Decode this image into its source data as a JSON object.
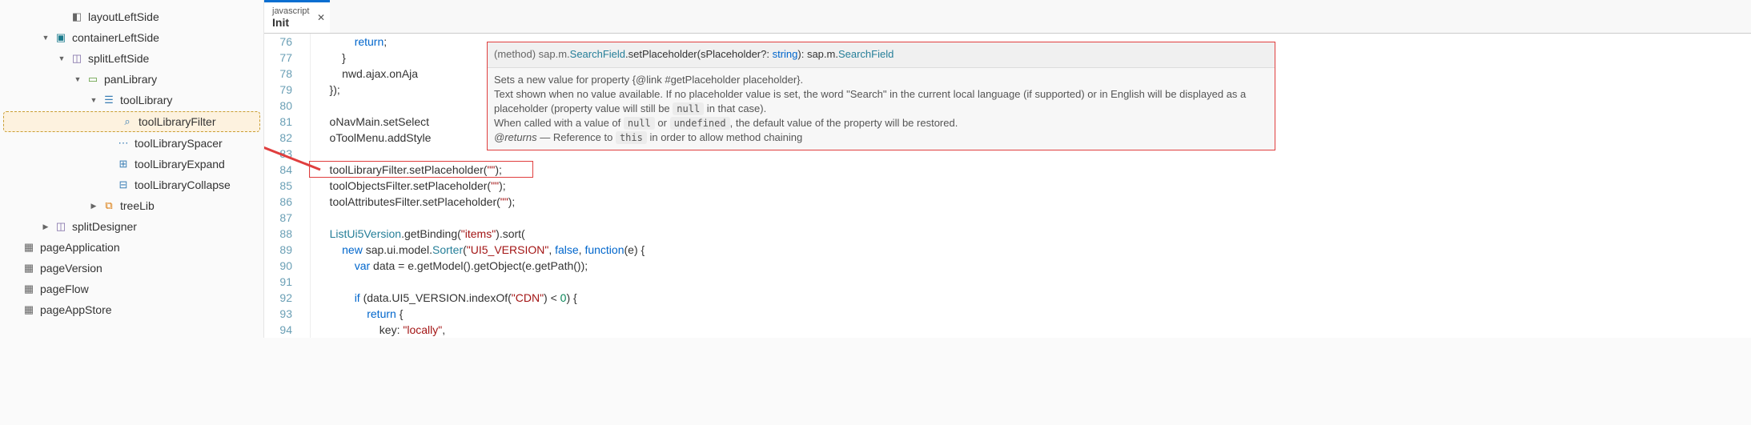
{
  "tree": {
    "items": [
      {
        "indent": 70,
        "chevron": "",
        "icon": "layout",
        "label": "layoutLeftSide",
        "iconClass": "page"
      },
      {
        "indent": 50,
        "chevron": "▼",
        "icon": "container",
        "label": "containerLeftSide",
        "iconClass": "box-teal"
      },
      {
        "indent": 70,
        "chevron": "▼",
        "icon": "split",
        "label": "splitLeftSide",
        "iconClass": "box-purple"
      },
      {
        "indent": 90,
        "chevron": "▼",
        "icon": "panel",
        "label": "panLibrary",
        "iconClass": "box-green"
      },
      {
        "indent": 110,
        "chevron": "▼",
        "icon": "tool",
        "label": "toolLibrary",
        "iconClass": "box-blue"
      },
      {
        "indent": 128,
        "chevron": "",
        "icon": "filter",
        "label": "toolLibraryFilter",
        "iconClass": "box-blue",
        "selected": true
      },
      {
        "indent": 128,
        "chevron": "",
        "icon": "spacer",
        "label": "toolLibrarySpacer",
        "iconClass": "box-blue"
      },
      {
        "indent": 128,
        "chevron": "",
        "icon": "expand",
        "label": "toolLibraryExpand",
        "iconClass": "box-blue"
      },
      {
        "indent": 128,
        "chevron": "",
        "icon": "collapse",
        "label": "toolLibraryCollapse",
        "iconClass": "box-blue"
      },
      {
        "indent": 110,
        "chevron": "▶",
        "icon": "tree",
        "label": "treeLib",
        "iconClass": "box-orange"
      },
      {
        "indent": 50,
        "chevron": "▶",
        "icon": "split",
        "label": "splitDesigner",
        "iconClass": "box-purple"
      },
      {
        "indent": 10,
        "chevron": "",
        "icon": "page",
        "label": "pageApplication",
        "iconClass": "page"
      },
      {
        "indent": 10,
        "chevron": "",
        "icon": "page",
        "label": "pageVersion",
        "iconClass": "page"
      },
      {
        "indent": 10,
        "chevron": "",
        "icon": "page",
        "label": "pageFlow",
        "iconClass": "page"
      },
      {
        "indent": 10,
        "chevron": "",
        "icon": "page",
        "label": "pageAppStore",
        "iconClass": "page"
      }
    ]
  },
  "editor": {
    "tab": {
      "lang": "javascript",
      "name": "Init"
    },
    "lines": [
      {
        "num": 76,
        "code": "            return;"
      },
      {
        "num": 77,
        "code": "        }"
      },
      {
        "num": 78,
        "code": "        nwd.ajax.onAja"
      },
      {
        "num": 79,
        "code": "    });"
      },
      {
        "num": 80,
        "code": ""
      },
      {
        "num": 81,
        "code": "    oNavMain.setSelect"
      },
      {
        "num": 82,
        "code": "    oToolMenu.addStyle"
      },
      {
        "num": 83,
        "code": ""
      },
      {
        "num": 84,
        "code": "    toolLibraryFilter.setPlaceholder(\"\");"
      },
      {
        "num": 85,
        "code": "    toolObjectsFilter.setPlaceholder(\"\");"
      },
      {
        "num": 86,
        "code": "    toolAttributesFilter.setPlaceholder(\"\");"
      },
      {
        "num": 87,
        "code": ""
      },
      {
        "num": 88,
        "code": "    ListUi5Version.getBinding(\"items\").sort("
      },
      {
        "num": 89,
        "code": "        new sap.ui.model.Sorter(\"UI5_VERSION\", false, function(e) {"
      },
      {
        "num": 90,
        "code": "            var data = e.getModel().getObject(e.getPath());"
      },
      {
        "num": 91,
        "code": ""
      },
      {
        "num": 92,
        "code": "            if (data.UI5_VERSION.indexOf(\"CDN\") < 0) {"
      },
      {
        "num": 93,
        "code": "                return {"
      },
      {
        "num": 94,
        "code": "                    key: \"locally\","
      }
    ]
  },
  "tooltip": {
    "sig_prefix": "(method) sap.m.",
    "sig_class": "SearchField",
    "sig_method": ".setPlaceholder(sPlaceholder?: ",
    "sig_type": "string",
    "sig_ret_prefix": "): sap.m.",
    "sig_ret_class": "SearchField",
    "body_l1": "Sets a new value for property {@link #getPlaceholder placeholder}.",
    "body_l2a": "Text shown when no value available. If no placeholder value is set, the word \"Search\" in the current local language (if supported) or in English will be displayed as a placeholder (property value will still be ",
    "body_l2_tok": "null",
    "body_l2b": " in that case).",
    "body_l3a": "When called with a value of ",
    "body_l3_tok1": "null",
    "body_l3b": " or ",
    "body_l3_tok2": "undefined",
    "body_l3c": ", the default value of the property will be restored.",
    "body_l4_em": "@returns",
    "body_l4a": " — Reference to ",
    "body_l4_tok": "this",
    "body_l4b": " in order to allow method chaining"
  }
}
